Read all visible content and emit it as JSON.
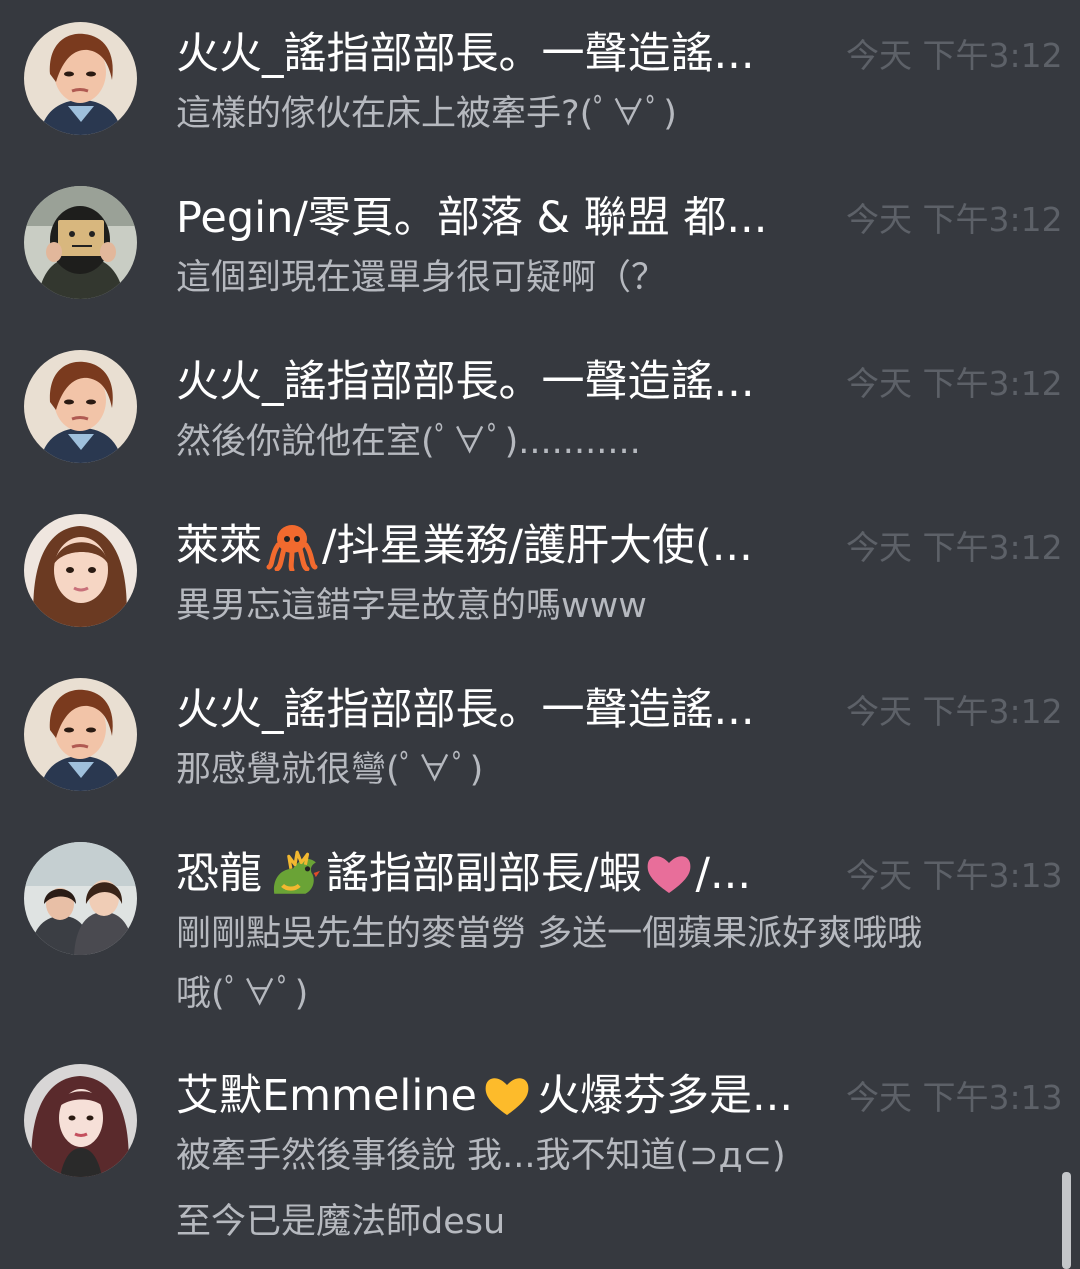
{
  "messages": [
    {
      "author": "火火_謠指部部長。一聲造謠...",
      "time": "今天 下午3:12",
      "lines": [
        "這樣的傢伙在床上被牽手?(ﾟ∀ﾟ)"
      ]
    },
    {
      "author": "Pegin/零頁。部落 & 聯盟 都...",
      "time": "今天 下午3:12",
      "lines": [
        "這個到現在還單身很可疑啊（？"
      ]
    },
    {
      "author": "火火_謠指部部長。一聲造謠...",
      "time": "今天 下午3:12",
      "lines": [
        "然後你說他在室(ﾟ∀ﾟ)..........."
      ]
    },
    {
      "author_parts": [
        "萊萊",
        "/抖星業務/護肝大使(..."
      ],
      "author_emoji": "octopus-emoji",
      "time": "今天 下午3:12",
      "lines": [
        "異男忘這錯字是故意的嗎www"
      ]
    },
    {
      "author": "火火_謠指部部長。一聲造謠...",
      "time": "今天 下午3:12",
      "lines": [
        "那感覺就很彎(ﾟ∀ﾟ)"
      ]
    },
    {
      "author_parts": [
        "恐龍",
        "謠指部副部長/蝦",
        "/..."
      ],
      "author_emojis": [
        "dragon-emoji",
        "pink-heart-emoji"
      ],
      "time": "今天 下午3:13",
      "lines": [
        "剛剛點吳先生的麥當勞 多送一個蘋果派好爽哦哦",
        "哦(ﾟ∀ﾟ)"
      ]
    },
    {
      "author_parts": [
        "艾默Emmeline",
        "火爆芬多是..."
      ],
      "author_emoji": "yellow-heart-emoji",
      "time": "今天 下午3:13",
      "lines": [
        "被牽手然後事後說 我...我不知道(⊃д⊂)",
        "至今已是魔法師desu"
      ]
    }
  ],
  "colors": {
    "background": "#36393f",
    "author": "#ffffff",
    "message": "#b6b9bf",
    "timestamp": "#5d6168"
  }
}
